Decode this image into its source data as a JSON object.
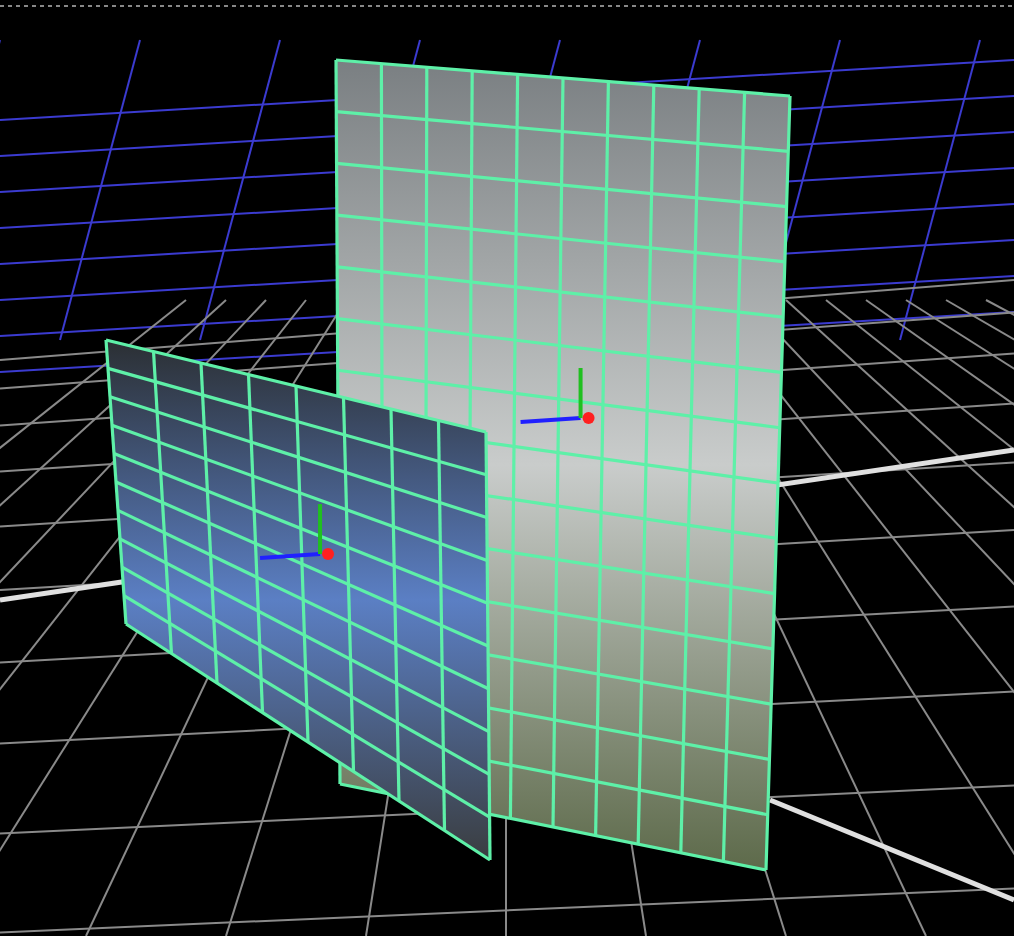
{
  "viewport": {
    "planes": [
      {
        "kind": "image",
        "grid": true
      },
      {
        "kind": "image",
        "grid": true
      }
    ]
  }
}
